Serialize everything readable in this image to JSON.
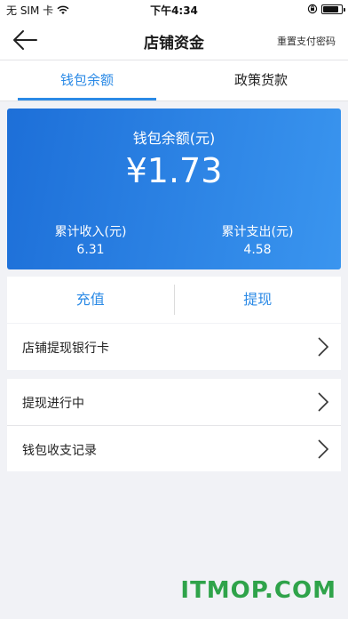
{
  "status_bar": {
    "carrier": "无 SIM 卡",
    "time": "下午4:34",
    "battery_level": 0.85
  },
  "nav": {
    "title": "店铺资金",
    "action_label": "重置支付密码"
  },
  "tabs": [
    {
      "label": "钱包余额",
      "active": true
    },
    {
      "label": "政策货款",
      "active": false
    }
  ],
  "balance": {
    "label": "钱包余额(元)",
    "amount": "¥1.73",
    "income_label": "累计收入(元)",
    "income_value": "6.31",
    "expense_label": "累计支出(元)",
    "expense_value": "4.58"
  },
  "actions": {
    "recharge_label": "充值",
    "withdraw_label": "提现"
  },
  "menu": {
    "bank_card": "店铺提现银行卡",
    "withdraw_in_progress": "提现进行中",
    "wallet_records": "钱包收支记录"
  },
  "watermark": "ITMOP.COM",
  "colors": {
    "accent": "#2b8ae6",
    "card_start": "#1d6fd8",
    "card_end": "#3a95ef",
    "watermark": "#2fa34a"
  }
}
